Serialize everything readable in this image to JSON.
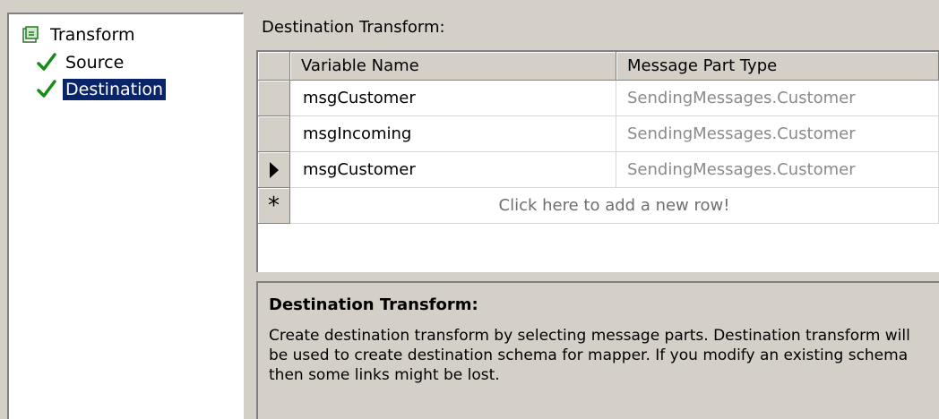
{
  "tree": {
    "root_label": "Transform",
    "items": [
      {
        "label": "Source",
        "checked": true,
        "selected": false
      },
      {
        "label": "Destination",
        "checked": true,
        "selected": true
      }
    ]
  },
  "section_title": "Destination Transform:",
  "grid": {
    "columns": [
      "Variable Name",
      "Message Part Type"
    ],
    "rows": [
      {
        "variable": "msgCustomer",
        "type": "SendingMessages.Customer",
        "current": false
      },
      {
        "variable": "msgIncoming",
        "type": "SendingMessages.Customer",
        "current": false
      },
      {
        "variable": "msgCustomer",
        "type": "SendingMessages.Customer",
        "current": true
      }
    ],
    "new_row_marker": "*",
    "new_row_text": "Click here to add a new row!"
  },
  "description": {
    "title": "Destination Transform:",
    "text": "Create destination transform by selecting message parts. Destination transform will be used to create destination schema for mapper. If you modify an existing schema then some links might be lost."
  },
  "colors": {
    "background": "#d4d0c8",
    "selection": "#0a246a",
    "check": "#1a8a1a",
    "type_text": "#8a8a8a"
  }
}
